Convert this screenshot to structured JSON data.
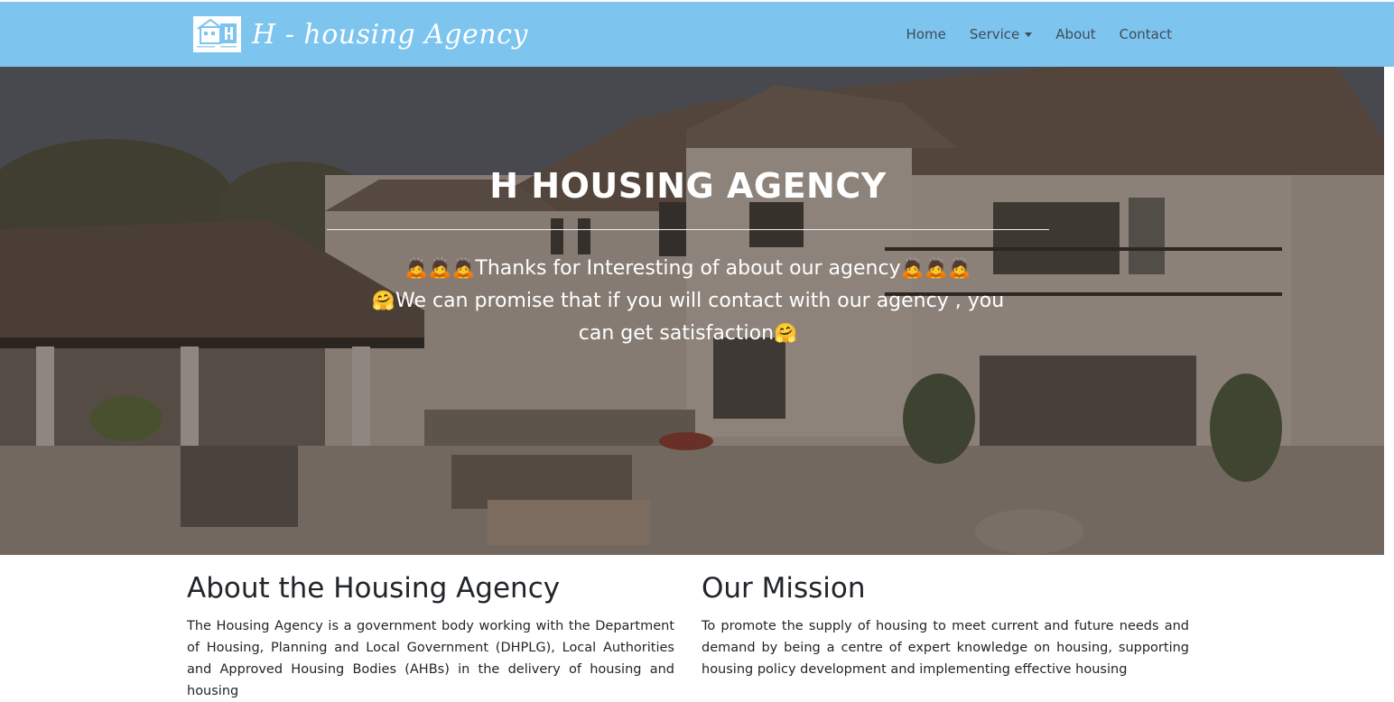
{
  "navbar": {
    "brand_text": "H - housing Agency",
    "logo_icon": "house-logo-icon",
    "links": {
      "home": "Home",
      "service": "Service",
      "about": "About",
      "contact": "Contact"
    },
    "background_color": "#7dc4ef"
  },
  "hero": {
    "title": "H HOUSING AGENCY",
    "line1_emoji_left": "🙇🙇🙇",
    "line1_text": "Thanks for Interesting of about our agency",
    "line1_emoji_right": "🙇🙇🙇",
    "line2_emoji_left": "🤗",
    "line2_text": "We can promise that if you will contact with our agency , you can get satisfaction",
    "line2_emoji_right": "🤗"
  },
  "about": {
    "heading": "About the Housing Agency",
    "body": "The Housing Agency is a government body working with the Department of Housing, Planning and Local Government (DHPLG), Local Authorities and Approved Housing Bodies (AHBs) in the delivery of housing and housing"
  },
  "mission": {
    "heading": "Our Mission",
    "body": "To promote the supply of housing to meet current and future needs and demand by being a centre of expert knowledge on housing, supporting housing policy development and implementing effective housing"
  }
}
